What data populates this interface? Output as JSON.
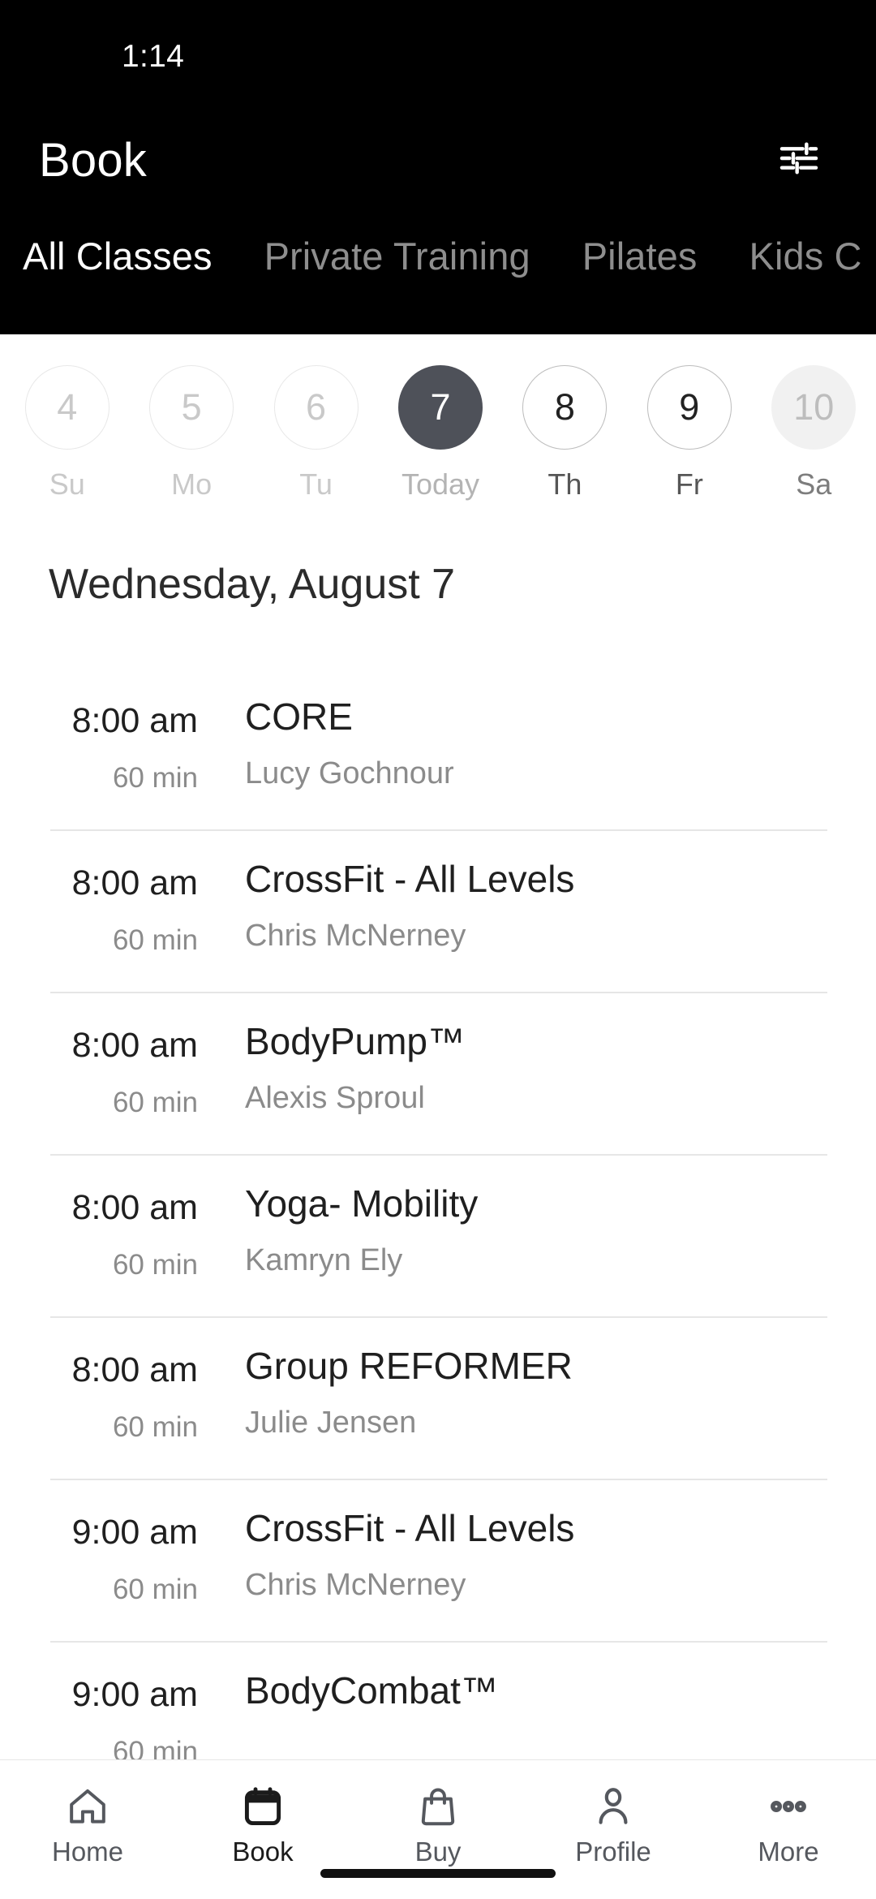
{
  "status_bar": {
    "time": "1:14"
  },
  "header": {
    "title": "Book",
    "filter_icon": "tune-sliders-icon",
    "tabs": [
      {
        "label": "All Classes",
        "active": true
      },
      {
        "label": "Private Training",
        "active": false
      },
      {
        "label": "Pilates",
        "active": false
      },
      {
        "label": "Kids C",
        "active": false
      }
    ]
  },
  "day_strip": [
    {
      "number": "4",
      "weekday": "Su",
      "state": "disabled"
    },
    {
      "number": "5",
      "weekday": "Mo",
      "state": "disabled"
    },
    {
      "number": "6",
      "weekday": "Tu",
      "state": "disabled"
    },
    {
      "number": "7",
      "weekday": "Today",
      "state": "selected"
    },
    {
      "number": "8",
      "weekday": "Th",
      "state": "enabled"
    },
    {
      "number": "9",
      "weekday": "Fr",
      "state": "enabled"
    },
    {
      "number": "10",
      "weekday": "Sa",
      "state": "filled"
    }
  ],
  "date_heading": "Wednesday, August 7",
  "classes": [
    {
      "time": "8:00 am",
      "duration": "60 min",
      "name": "CORE",
      "coach": "Lucy Gochnour"
    },
    {
      "time": "8:00 am",
      "duration": "60 min",
      "name": "CrossFit - All Levels",
      "coach": "Chris McNerney"
    },
    {
      "time": "8:00 am",
      "duration": "60 min",
      "name": "BodyPump™",
      "coach": "Alexis Sproul"
    },
    {
      "time": "8:00 am",
      "duration": "60 min",
      "name": "Yoga- Mobility",
      "coach": "Kamryn Ely"
    },
    {
      "time": "8:00 am",
      "duration": "60 min",
      "name": "Group REFORMER",
      "coach": "Julie Jensen"
    },
    {
      "time": "9:00 am",
      "duration": "60 min",
      "name": "CrossFit - All Levels",
      "coach": "Chris McNerney"
    },
    {
      "time": "9:00 am",
      "duration": "60 min",
      "name": "BodyCombat™",
      "coach": ""
    }
  ],
  "bottom_nav": [
    {
      "label": "Home",
      "icon": "home-icon",
      "active": false
    },
    {
      "label": "Book",
      "icon": "calendar-icon",
      "active": true
    },
    {
      "label": "Buy",
      "icon": "bag-icon",
      "active": false
    },
    {
      "label": "Profile",
      "icon": "person-icon",
      "active": false
    },
    {
      "label": "More",
      "icon": "ellipsis-icon",
      "active": false
    }
  ],
  "colors": {
    "header_bg": "#000000",
    "selected_day": "#4e5159",
    "body_bg": "#ffffff",
    "divider": "#e6e6e6",
    "muted_text": "#8b8b8b"
  }
}
